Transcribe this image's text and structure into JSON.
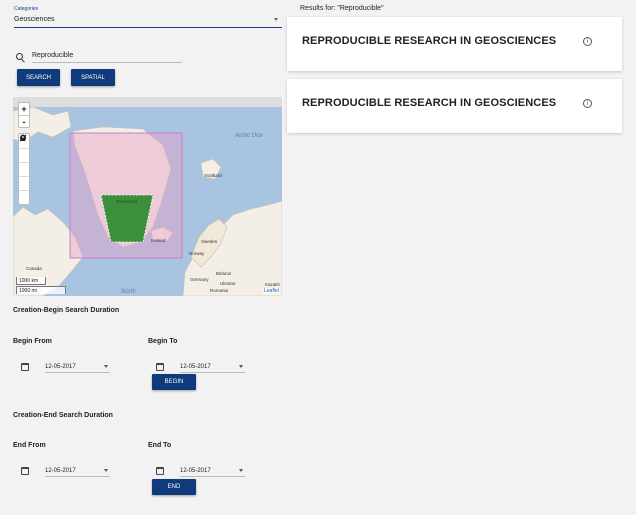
{
  "filters": {
    "categories_label": "Categories",
    "categories_value": "Geosciences",
    "search_value": "Reproducible",
    "search_button": "SEARCH",
    "spatial_button": "SPATIAL"
  },
  "map": {
    "zoom_in": "+",
    "zoom_out": "-",
    "scale_km": "1000 km",
    "scale_mi": "1000 mi",
    "attribution": "Leaflet",
    "places": {
      "arctic_ocean": "Arctic Oce",
      "svalbard": "Svalbard",
      "greenland": "Greenland",
      "iceland": "Iceland",
      "sweden": "Sweden",
      "norway": "Norway",
      "canada": "Canada",
      "belarus": "Belarus",
      "germany": "Germany",
      "ukraine": "Ukraine",
      "kazakh": "Kazakh",
      "romania": "Romania",
      "north": "North"
    }
  },
  "creation_begin": {
    "title": "Creation-Begin Search Duration",
    "from_label": "Begin From",
    "from_value": "12-05-2017",
    "to_label": "Begin To",
    "to_value": "12-05-2017",
    "button": "BEGIN"
  },
  "creation_end": {
    "title": "Creation-End Search Duration",
    "from_label": "End From",
    "from_value": "12-05-2017",
    "to_label": "End To",
    "to_value": "12-05-2017",
    "button": "END"
  },
  "results": {
    "label": "Results for: \"Reproducible\"",
    "items": [
      {
        "title": "REPRODUCIBLE RESEARCH IN GEOSCIENCES",
        "info_glyph": "i"
      },
      {
        "title": "REPRODUCIBLE RESEARCH IN GEOSCIENCES",
        "info_glyph": "i"
      }
    ]
  },
  "colors": {
    "primary": "#0f3b7c",
    "selection_fill": "#2e8b2e",
    "bbox_stroke": "#c87ec8"
  }
}
